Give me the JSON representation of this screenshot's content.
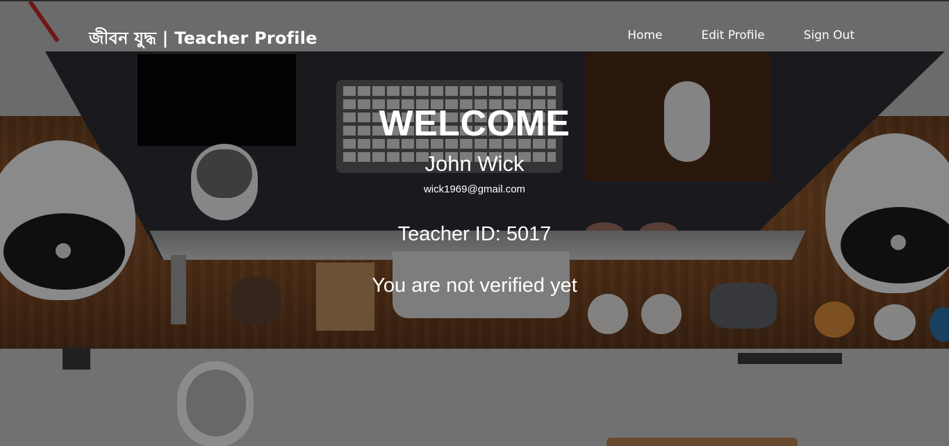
{
  "navbar": {
    "brand": "জীবন যুদ্ধ | Teacher Profile",
    "links": [
      {
        "label": "Home"
      },
      {
        "label": "Edit Profile"
      },
      {
        "label": "Sign Out"
      }
    ]
  },
  "profile": {
    "heading": "WELCOME",
    "name": "John Wick",
    "email": "wick1969@gmail.com",
    "teacher_id_text": "Teacher ID: 5017",
    "verification_status": "You are not verified yet"
  },
  "colors": {
    "text": "#ffffff",
    "overlay": "rgba(0,0,0,0.42)"
  }
}
